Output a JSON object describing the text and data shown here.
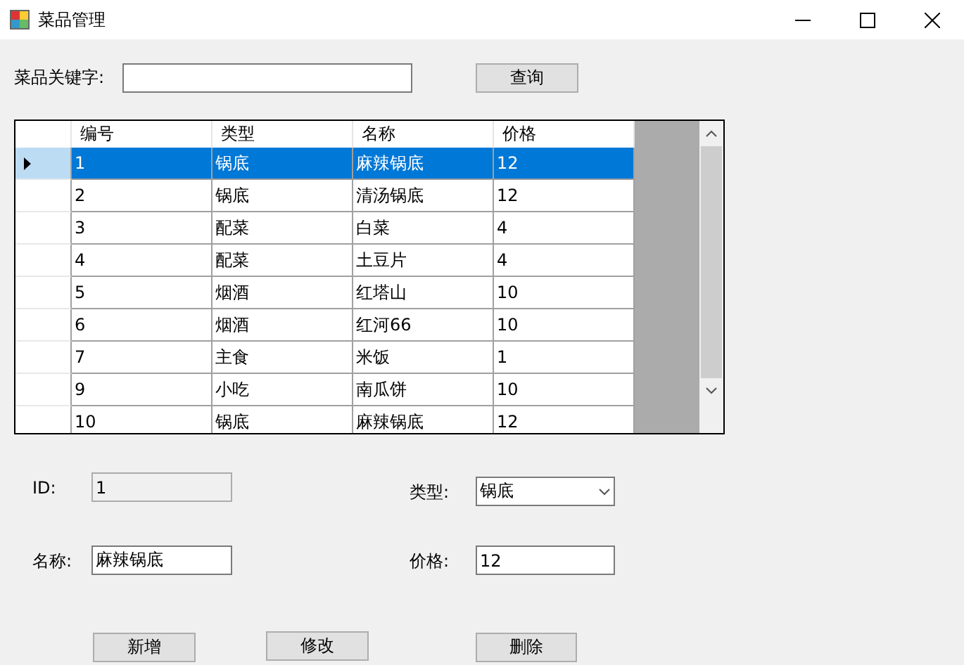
{
  "window": {
    "title": "菜品管理"
  },
  "search": {
    "label": "菜品关键字:",
    "button": "查询"
  },
  "table": {
    "columns": [
      "编号",
      "类型",
      "名称",
      "价格"
    ],
    "rows": [
      {
        "cells": [
          "1",
          "锅底",
          "麻辣锅底",
          "12"
        ],
        "selected": true
      },
      {
        "cells": [
          "2",
          "锅底",
          "清汤锅底",
          "12"
        ],
        "selected": false
      },
      {
        "cells": [
          "3",
          "配菜",
          "白菜",
          "4"
        ],
        "selected": false
      },
      {
        "cells": [
          "4",
          "配菜",
          "土豆片",
          "4"
        ],
        "selected": false
      },
      {
        "cells": [
          "5",
          "烟酒",
          "红塔山",
          "10"
        ],
        "selected": false
      },
      {
        "cells": [
          "6",
          "烟酒",
          "红河66",
          "10"
        ],
        "selected": false
      },
      {
        "cells": [
          "7",
          "主食",
          "米饭",
          "1"
        ],
        "selected": false
      },
      {
        "cells": [
          "9",
          "小吃",
          "南瓜饼",
          "10"
        ],
        "selected": false
      },
      {
        "cells": [
          "10",
          "锅底",
          "麻辣锅底",
          "12"
        ],
        "selected": false
      }
    ]
  },
  "form": {
    "id": {
      "label": "ID:",
      "value": "1",
      "disabled": true
    },
    "type": {
      "label": "类型:",
      "value": "锅底"
    },
    "name": {
      "label": "名称:",
      "value": "麻辣锅底"
    },
    "price": {
      "label": "价格:",
      "value": "12"
    }
  },
  "buttons": [
    "新增",
    "修改",
    "删除"
  ]
}
